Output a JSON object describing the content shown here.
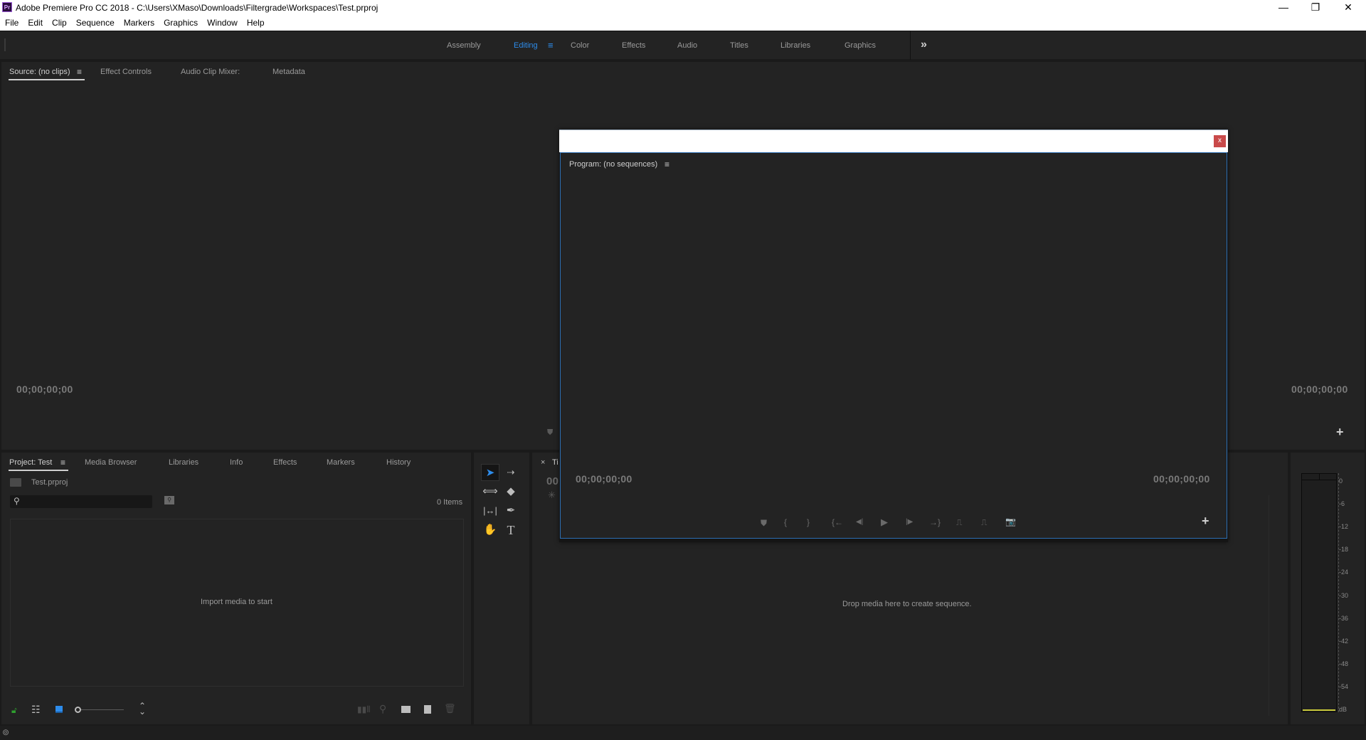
{
  "window": {
    "app_icon": "Pr",
    "title": "Adobe Premiere Pro CC 2018 - C:\\Users\\XMaso\\Downloads\\Filtergrade\\Workspaces\\Test.prproj",
    "minimize": "—",
    "restore": "❐",
    "close": "✕"
  },
  "menu": [
    "File",
    "Edit",
    "Clip",
    "Sequence",
    "Markers",
    "Graphics",
    "Window",
    "Help"
  ],
  "workspaces": {
    "tabs": [
      "Assembly",
      "Editing",
      "Color",
      "Effects",
      "Audio",
      "Titles",
      "Libraries",
      "Graphics"
    ],
    "active": "Editing",
    "menu_icon": "≡",
    "overflow_icon": "»"
  },
  "source_panel": {
    "tabs": [
      "Source: (no clips)",
      "Effect Controls",
      "Audio Clip Mixer:",
      "Metadata"
    ],
    "menu_icon": "≡",
    "timecode_left": "00;00;00;00",
    "timecode_right": "00;00;00;00",
    "add_icon": "+"
  },
  "floating_window": {
    "close_label": "x",
    "program_title": "Program: (no sequences)",
    "menu_icon": "≡",
    "timecode_left": "00;00;00;00",
    "timecode_right": "00;00;00;00",
    "transport": {
      "marker": "⛊",
      "mark_in": "{",
      "mark_out": "}",
      "go_to_in": "{←",
      "step_back": "◀|",
      "play": "▶",
      "step_forward": "|▶",
      "go_to_out": "→}",
      "lift": "⎍",
      "extract": "⎍",
      "export_frame": "📷",
      "add": "+"
    }
  },
  "project_panel": {
    "tabs": [
      "Project: Test",
      "Media Browser",
      "Libraries",
      "Info",
      "Effects",
      "Markers",
      "History"
    ],
    "menu_icon": "≡",
    "file_name": "Test.prproj",
    "search_placeholder": "",
    "item_count": "0 Items",
    "empty_message": "Import media to start"
  },
  "timeline_panel": {
    "tab_close": "×",
    "tab_label": "Ti",
    "timecode": "00",
    "empty_message": "Drop media here to create sequence."
  },
  "audio_meter": {
    "ticks": [
      "0",
      "-6",
      "-12",
      "-18",
      "-24",
      "-30",
      "-36",
      "-42",
      "-48",
      "-54",
      "dB"
    ]
  },
  "colors": {
    "accent": "#2d8ceb",
    "panel_bg": "#232323",
    "close_red": "#c94a4a",
    "lock_green": "#2fa02f"
  }
}
